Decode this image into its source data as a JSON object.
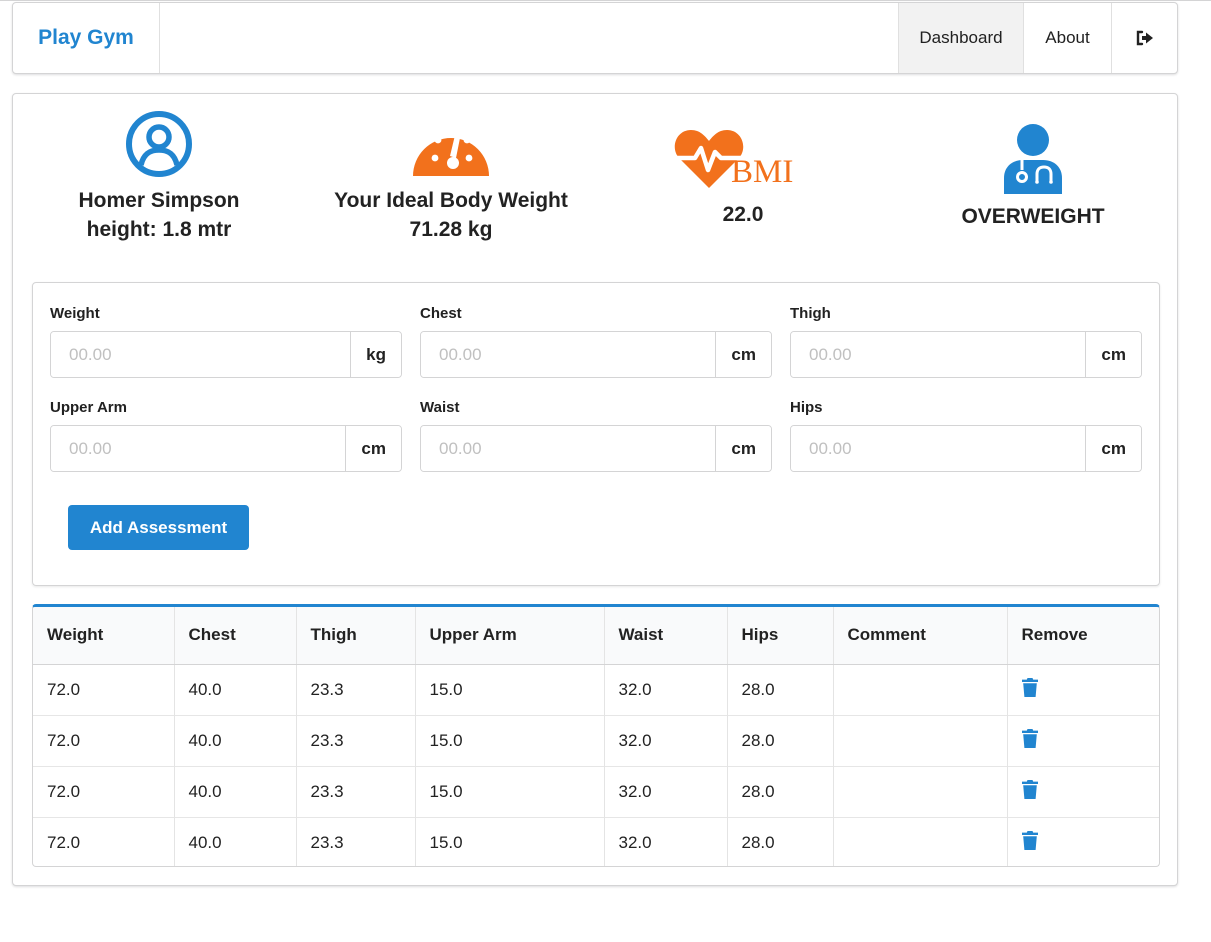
{
  "navbar": {
    "brand": "Play Gym",
    "items": [
      {
        "label": "Dashboard"
      },
      {
        "label": "About"
      }
    ],
    "logout_icon": "sign-out-icon"
  },
  "stats": {
    "member": {
      "icon": "user-circle-icon",
      "name": "Homer Simpson",
      "height": "height: 1.8 mtr"
    },
    "ideal": {
      "icon": "tachometer-icon",
      "label": "Your Ideal Body Weight",
      "value": "71.28 kg"
    },
    "bmi": {
      "icon": "heartbeat-bmi-icon",
      "icon_text": "BMI",
      "value": "22.0"
    },
    "category": {
      "icon": "doctor-icon",
      "value": "OVERWEIGHT"
    }
  },
  "colors": {
    "primary": "#2185d0",
    "accent": "#f2711c"
  },
  "form": {
    "fields": [
      {
        "label": "Weight",
        "placeholder": "00.00",
        "unit": "kg"
      },
      {
        "label": "Chest",
        "placeholder": "00.00",
        "unit": "cm"
      },
      {
        "label": "Thigh",
        "placeholder": "00.00",
        "unit": "cm"
      },
      {
        "label": "Upper Arm",
        "placeholder": "00.00",
        "unit": "cm"
      },
      {
        "label": "Waist",
        "placeholder": "00.00",
        "unit": "cm"
      },
      {
        "label": "Hips",
        "placeholder": "00.00",
        "unit": "cm"
      }
    ],
    "submit_label": "Add Assessment"
  },
  "table": {
    "headers": [
      "Weight",
      "Chest",
      "Thigh",
      "Upper Arm",
      "Waist",
      "Hips",
      "Comment",
      "Remove"
    ],
    "rows": [
      [
        "72.0",
        "40.0",
        "23.3",
        "15.0",
        "32.0",
        "28.0",
        ""
      ],
      [
        "72.0",
        "40.0",
        "23.3",
        "15.0",
        "32.0",
        "28.0",
        ""
      ],
      [
        "72.0",
        "40.0",
        "23.3",
        "15.0",
        "32.0",
        "28.0",
        ""
      ],
      [
        "72.0",
        "40.0",
        "23.3",
        "15.0",
        "32.0",
        "28.0",
        ""
      ]
    ],
    "remove_icon": "trash-icon"
  }
}
